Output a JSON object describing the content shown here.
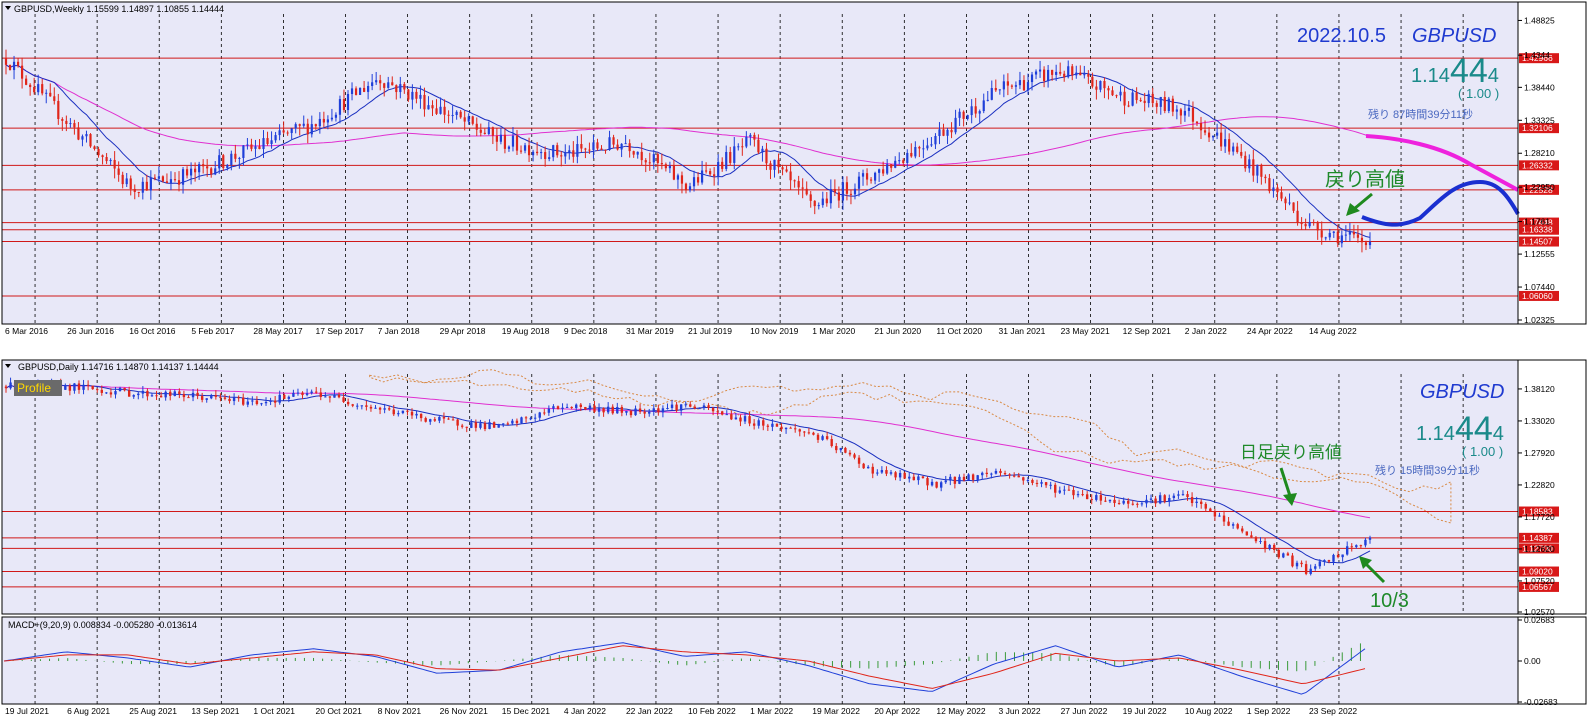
{
  "colors": {
    "bg": "#e8e8f8",
    "up": "#1f3fd9",
    "down": "#e0261a",
    "ma_short": "#1a2fc0",
    "ma_long": "#e030d0",
    "hline": "#d01818",
    "label_bg": "#d81818",
    "grid": "#000000",
    "cloud": "#d98a45",
    "accent_green": "#1f8a2a",
    "arrow_green": "#1f8a1f",
    "title_blue": "#1f3ad0",
    "price_teal": "#1a8a8a",
    "signal_red": "#e0261a",
    "hist_green": "#3a9a3a"
  },
  "weekly": {
    "header": "GBPUSD,Weekly  1.15599 1.14897 1.10855 1.14444",
    "date_text": "2022.10.5",
    "symbol": "GBPUSD",
    "price_main": "1.14",
    "price_big": "44",
    "price_small": "4",
    "spread": "( 1.00 )",
    "remaining": "残り 87時間39分11秒",
    "annotation": "戻り高値",
    "y_axis_ticks": [
      1.48825,
      1.4344,
      1.3844,
      1.33325,
      1.2821,
      1.2295,
      1.1761,
      1.12555,
      1.0744,
      1.02325
    ],
    "y_axis_tick_labels": [
      "1.48825",
      "1.4344",
      "1.38440",
      "1.33325",
      "1.28210",
      "1.22950",
      "1.1761",
      "1.12555",
      "1.07440",
      "1.02325"
    ],
    "x_axis_labels": [
      "6 Mar 2016",
      "26 Jun 2016",
      "16 Oct 2016",
      "5 Feb 2017",
      "28 May 2017",
      "17 Sep 2017",
      "7 Jan 2018",
      "29 Apr 2018",
      "19 Aug 2018",
      "9 Dec 2018",
      "31 Mar 2019",
      "21 Jul 2019",
      "10 Nov 2019",
      "1 Mar 2020",
      "21 Jun 2020",
      "11 Oct 2020",
      "31 Jan 2021",
      "23 May 2021",
      "12 Sep 2021",
      "2 Jan 2022",
      "24 Apr 2022",
      "14 Aug 2022"
    ],
    "levels": [
      {
        "value": 1.42966,
        "label": "1.42966"
      },
      {
        "value": 1.32106,
        "label": "1.32106"
      },
      {
        "value": 1.26332,
        "label": "1.26332"
      },
      {
        "value": 1.22528,
        "label": "1.22528"
      },
      {
        "value": 1.17448,
        "label": "1.17448"
      },
      {
        "value": 1.16338,
        "label": "1.16338"
      },
      {
        "value": 1.14507,
        "label": "1.14507"
      },
      {
        "value": 1.0606,
        "label": "1.06060"
      }
    ]
  },
  "daily": {
    "header": "GBPUSD,Daily  1.14716 1.14870 1.14137 1.14444",
    "profile_label": "Profile",
    "symbol": "GBPUSD",
    "price_main": "1.14",
    "price_big": "44",
    "price_small": "4",
    "spread": "( 1.00 )",
    "remaining": "残り 15時間39分11秒",
    "annotation1": "日足戻り高値",
    "annotation2": "10/3",
    "y_axis_tick_labels": [
      "1.38120",
      "1.33020",
      "1.27920",
      "1.22820",
      "1.17720",
      "1.12620",
      "1.07520",
      "1.02570"
    ],
    "x_axis_labels": [
      "19 Jul 2021",
      "6 Aug 2021",
      "25 Aug 2021",
      "13 Sep 2021",
      "1 Oct 2021",
      "20 Oct 2021",
      "8 Nov 2021",
      "26 Nov 2021",
      "15 Dec 2021",
      "4 Jan 2022",
      "22 Jan 2022",
      "10 Feb 2022",
      "1 Mar 2022",
      "19 Mar 2022",
      "20 Apr 2022",
      "12 May 2022",
      "3 Jun 2022",
      "27 Jun 2022",
      "19 Jul 2022",
      "10 Aug 2022",
      "1 Sep 2022",
      "23 Sep 2022"
    ],
    "levels": [
      {
        "value": 1.18583,
        "label": "1.18583"
      },
      {
        "value": 1.14387,
        "label": "1.14387"
      },
      {
        "value": 1.127,
        "label": "1.12700"
      },
      {
        "value": 1.0902,
        "label": "1.09020"
      },
      {
        "value": 1.06567,
        "label": "1.06567"
      }
    ]
  },
  "macd": {
    "header": "MACD+(9,20,9) 0.008334 -0.005280 -0.013614",
    "y_axis_tick_labels": [
      "0.02683",
      "0.00",
      "-0.02683"
    ]
  },
  "chart_data": [
    {
      "type": "candlestick",
      "title": "GBPUSD,Weekly",
      "ylim": [
        1.02325,
        1.49825
      ],
      "x": [
        "6 Mar 2016",
        "26 Jun 2016",
        "16 Oct 2016",
        "5 Feb 2017",
        "28 May 2017",
        "17 Sep 2017",
        "7 Jan 2018",
        "29 Apr 2018",
        "19 Aug 2018",
        "9 Dec 2018",
        "31 Mar 2019",
        "21 Jul 2019",
        "10 Nov 2019",
        "1 Mar 2020",
        "21 Jun 2020",
        "11 Oct 2020",
        "31 Jan 2021",
        "23 May 2021",
        "12 Sep 2021",
        "2 Jan 2022",
        "24 Apr 2022",
        "14 Aug 2022"
      ],
      "close_path": [
        1.43,
        1.33,
        1.23,
        1.25,
        1.29,
        1.33,
        1.4,
        1.35,
        1.3,
        1.28,
        1.3,
        1.23,
        1.3,
        1.2,
        1.25,
        1.31,
        1.38,
        1.41,
        1.37,
        1.35,
        1.27,
        1.17,
        1.14
      ],
      "last": {
        "open": 1.15599,
        "high": 1.14897,
        "low": 1.10855,
        "close": 1.14444
      },
      "y_ticks": [
        1.48825,
        1.4344,
        1.3844,
        1.33325,
        1.2821,
        1.2295,
        1.1761,
        1.12555,
        1.0744,
        1.02325
      ]
    },
    {
      "type": "candlestick",
      "title": "GBPUSD,Daily",
      "ylim": [
        1.0257,
        1.405
      ],
      "x": [
        "19 Jul 2021",
        "6 Aug 2021",
        "25 Aug 2021",
        "13 Sep 2021",
        "1 Oct 2021",
        "20 Oct 2021",
        "8 Nov 2021",
        "26 Nov 2021",
        "15 Dec 2021",
        "4 Jan 2022",
        "22 Jan 2022",
        "10 Feb 2022",
        "1 Mar 2022",
        "19 Mar 2022",
        "20 Apr 2022",
        "12 May 2022",
        "3 Jun 2022",
        "27 Jun 2022",
        "19 Jul 2022",
        "10 Aug 2022",
        "1 Sep 2022",
        "23 Sep 2022"
      ],
      "close_path": [
        1.385,
        1.385,
        1.375,
        1.37,
        1.36,
        1.375,
        1.35,
        1.33,
        1.32,
        1.355,
        1.345,
        1.355,
        1.33,
        1.31,
        1.25,
        1.23,
        1.25,
        1.22,
        1.2,
        1.21,
        1.15,
        1.09,
        1.144
      ],
      "last": {
        "open": 1.14716,
        "high": 1.1487,
        "low": 1.14137,
        "close": 1.14444
      },
      "y_ticks": [
        1.3812,
        1.3302,
        1.2792,
        1.2282,
        1.1772,
        1.1262,
        1.0752,
        1.0257
      ]
    },
    {
      "type": "line",
      "title": "MACD+(9,20,9)",
      "ylim": [
        -0.02683,
        0.02683
      ],
      "series": [
        {
          "name": "MACD",
          "values": [
            0.0,
            0.006,
            0.002,
            -0.004,
            0.004,
            0.008,
            0.003,
            -0.008,
            -0.006,
            0.006,
            0.012,
            0.003,
            0.006,
            -0.003,
            -0.015,
            -0.02,
            -0.002,
            0.01,
            -0.004,
            0.004,
            -0.01,
            -0.022,
            0.008
          ]
        },
        {
          "name": "Signal",
          "values": [
            0.0,
            0.004,
            0.004,
            -0.002,
            0.002,
            0.006,
            0.004,
            -0.005,
            -0.006,
            0.002,
            0.01,
            0.006,
            0.004,
            0.0,
            -0.01,
            -0.018,
            -0.008,
            0.005,
            0.0,
            0.002,
            -0.006,
            -0.015,
            -0.005
          ]
        }
      ],
      "last": {
        "macd": 0.008334,
        "signal": -0.00528,
        "histogram": -0.013614
      }
    }
  ]
}
